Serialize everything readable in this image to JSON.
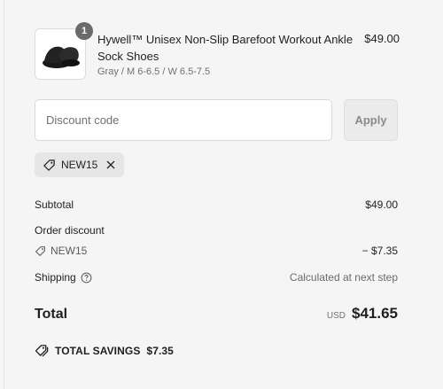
{
  "line_item": {
    "quantity": "1",
    "title": "Hywell™ Unisex Non-Slip Barefoot Workout Ankle Sock Shoes",
    "variant": "Gray / M 6-6.5 / W 6.5-7.5",
    "price": "$49.00",
    "image_icon": "shoe-image"
  },
  "discount": {
    "placeholder": "Discount code",
    "apply_label": "Apply",
    "applied_code": "NEW15"
  },
  "summary": {
    "subtotal_label": "Subtotal",
    "subtotal_value": "$49.00",
    "order_discount_label": "Order discount",
    "order_discount_code": "NEW15",
    "order_discount_value": "− $7.35",
    "shipping_label": "Shipping",
    "shipping_value": "Calculated at next step",
    "total_label": "Total",
    "currency": "USD",
    "total_value": "$41.65",
    "savings_label": "TOTAL SAVINGS",
    "savings_value": "$7.35"
  },
  "colors": {
    "background": "#f5f5f5",
    "apply_button": "#ebebeb",
    "tag_background": "#e6e6e6",
    "badge": "#6b6b6b"
  }
}
